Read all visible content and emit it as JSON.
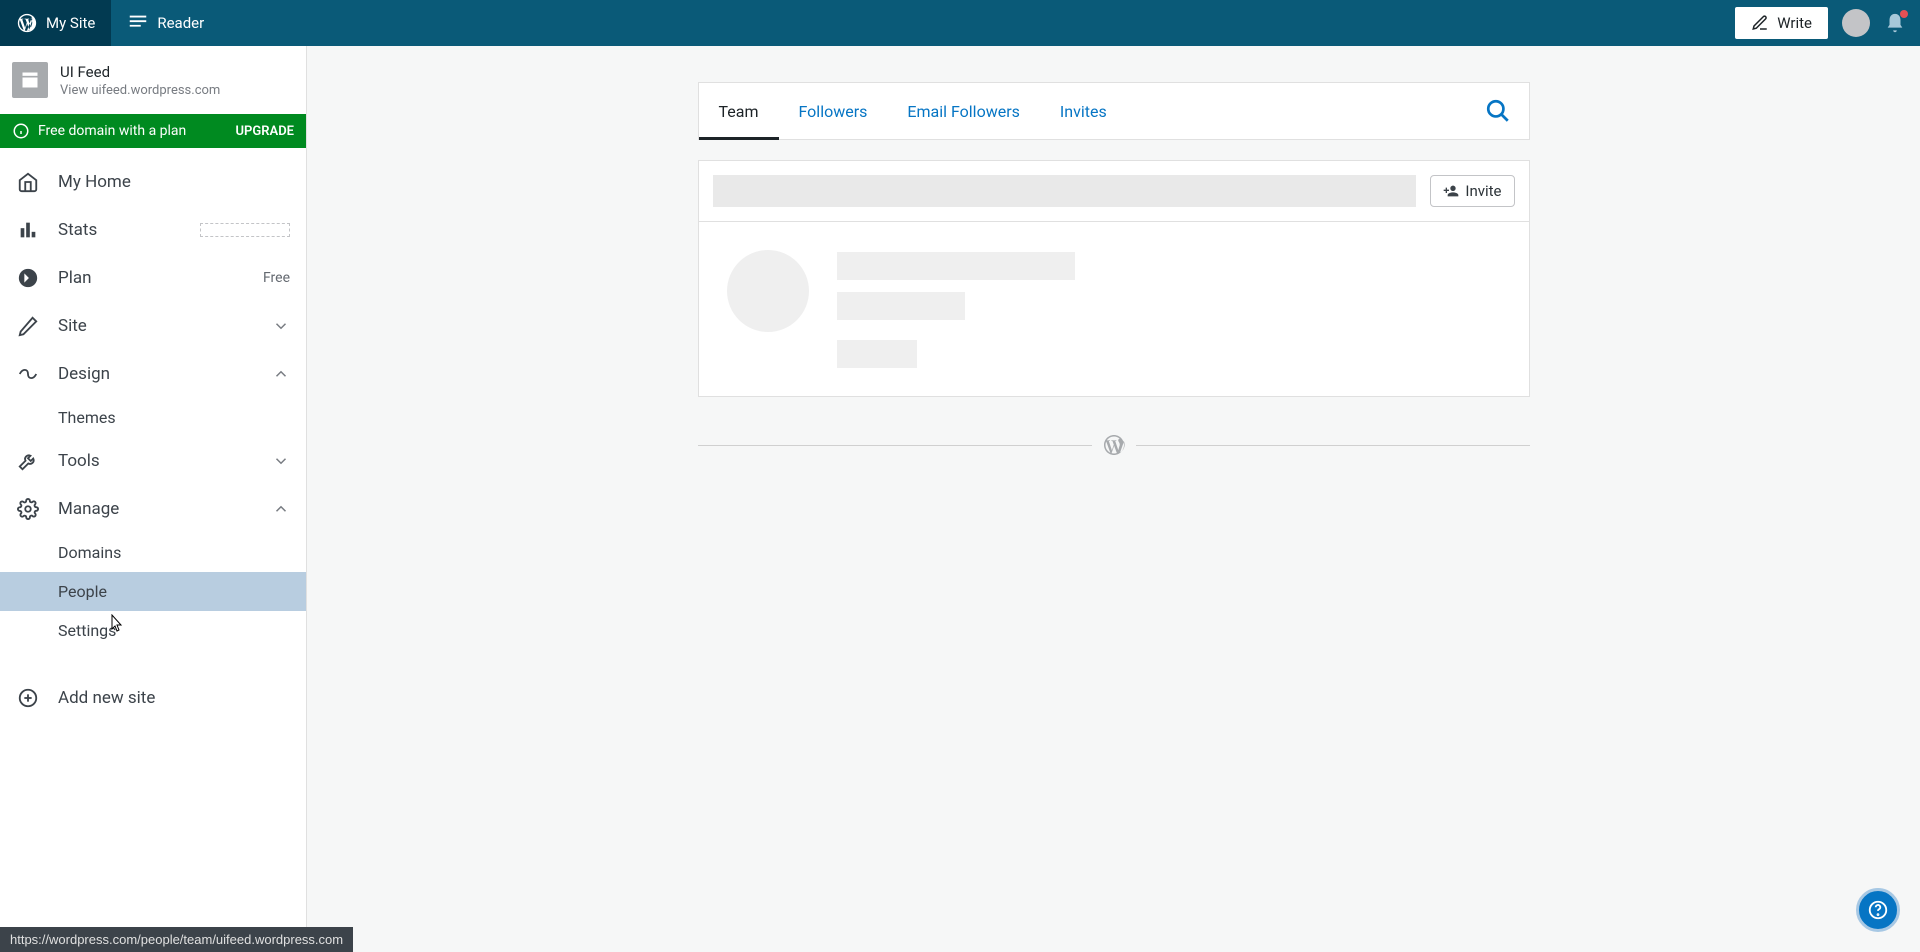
{
  "masterbar": {
    "my_site": "My Site",
    "reader": "Reader",
    "write": "Write"
  },
  "site": {
    "name": "UI Feed",
    "url_prefix": "View ",
    "url": "uifeed.wordpress.com"
  },
  "upsell": {
    "text": "Free domain with a plan",
    "cta": "UPGRADE"
  },
  "sidebar": {
    "my_home": "My Home",
    "stats": "Stats",
    "plan": "Plan",
    "plan_badge": "Free",
    "site": "Site",
    "design": "Design",
    "themes": "Themes",
    "tools": "Tools",
    "manage": "Manage",
    "domains": "Domains",
    "people": "People",
    "settings": "Settings",
    "add_site": "Add new site"
  },
  "tabs": {
    "team": "Team",
    "followers": "Followers",
    "email_followers": "Email Followers",
    "invites": "Invites"
  },
  "invite_btn": "Invite",
  "status_url": "https://wordpress.com/people/team/uifeed.wordpress.com"
}
